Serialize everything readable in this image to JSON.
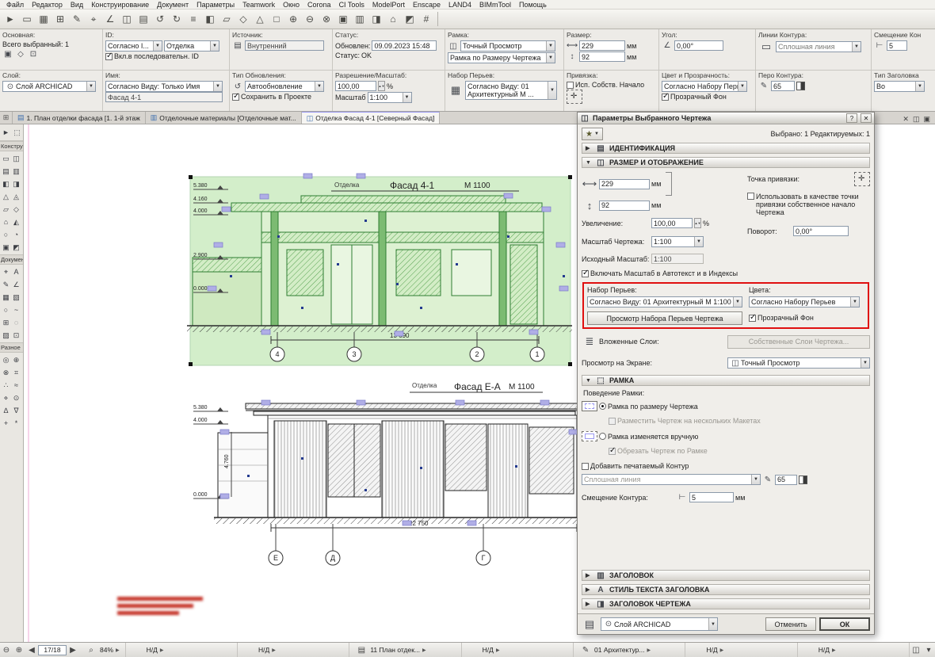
{
  "menubar": {
    "items": [
      "Файл",
      "Редактор",
      "Вид",
      "Конструирование",
      "Документ",
      "Параметры",
      "Teamwork",
      "Окно",
      "Corona",
      "CI Tools",
      "ModelPort",
      "Enscape",
      "LAND4",
      "BIMmTool",
      "Помощь"
    ]
  },
  "toolbar": {
    "icons": [
      "►",
      "▭",
      "▦",
      "⊞",
      "✎",
      "⌖",
      "∠",
      "◫",
      "▤",
      "↺",
      "↻",
      "≡",
      "◧",
      "▱",
      "◇",
      "△",
      "□",
      "⊕",
      "⊖",
      "⊗",
      "▣",
      "▥",
      "◨",
      "⌂",
      "◩",
      "#"
    ]
  },
  "infobox": {
    "basic": {
      "label": "Основная:",
      "selection": "Всего выбранный: 1"
    },
    "layer": {
      "label": "Слой:",
      "value": "Слой ARCHICAD"
    },
    "id": {
      "label": "ID:",
      "by": "Согласно I...",
      "value": "Отделка",
      "seq": "Вкл.в последовательн. ID"
    },
    "name": {
      "label": "Имя:",
      "by": "Согласно Виду: Только Имя",
      "value": "Фасад 4-1"
    },
    "source": {
      "label": "Источник:",
      "value": "Внутренний"
    },
    "update": {
      "label": "Тип Обновления:",
      "mode": "Автообновление",
      "store": "Сохранить в Проекте"
    },
    "status": {
      "label": "Статус:",
      "updated_label": "Обновлен:",
      "updated": "09.09.2023 15:48",
      "status_label": "Статус:",
      "status": "OK"
    },
    "resolution": {
      "label": "Разрешение/Масштаб:",
      "value": "100,00",
      "unit": "%",
      "scale_label": "Масштаб",
      "scale": "1:100"
    },
    "frame": {
      "label": "Рамка:",
      "preview": "Точный Просмотр",
      "mode": "Рамка по Размеру Чертежа"
    },
    "penset": {
      "label": "Набор Перьев:",
      "value": "Согласно Виду: 01 Архитектурный М ..."
    },
    "size": {
      "label": "Размер:",
      "width": "229",
      "height": "92",
      "unit": "мм"
    },
    "anchor": {
      "label": "Привязка:",
      "check": "Исп. Собств. Начало"
    },
    "angle": {
      "label": "Угол:",
      "value": "0,00°"
    },
    "color": {
      "label": "Цвет и Прозрачность:",
      "value": "Согласно Набору Перьев",
      "transparent": "Прозрачный Фон"
    },
    "contour": {
      "label": "Линии Контура:",
      "value": "Сплошная линия"
    },
    "pen": {
      "label": "Перо Контура:",
      "value": "65"
    },
    "offset": {
      "label": "Смещение Кон",
      "value": "5"
    },
    "titletype": {
      "label": "Тип Заголовка",
      "value": "Во"
    }
  },
  "tabs": {
    "items": [
      {
        "label": "1. План отделки фасада [1. 1-й этаж"
      },
      {
        "label": "Отделочные материалы [Отделочные мат..."
      },
      {
        "label": "Отделка Фасад 4-1 [Северный Фасад]"
      }
    ]
  },
  "palette": {
    "sections": [
      {
        "label": "Конструиро"
      },
      {
        "label": "Документы"
      },
      {
        "label": "Разное"
      }
    ],
    "construct_tools": [
      "▭",
      "◫",
      "▤",
      "▥",
      "◧",
      "◨",
      "△",
      "◬",
      "▱",
      "◇",
      "⌂",
      "◭",
      "○",
      "◔",
      "▣",
      "◩"
    ],
    "document_tools": [
      "⌖",
      "A",
      "✎",
      "∠",
      "▦",
      "▧",
      "○",
      "~",
      "⊞",
      "◌",
      "▨",
      "⊡"
    ],
    "misc_tools": [
      "◎",
      "⊕",
      "⊗",
      "⌗",
      "∴",
      "≈",
      "⋄",
      "⊙",
      "∆",
      "∇",
      "+",
      "*"
    ]
  },
  "canvas": {
    "d1": {
      "prefix": "Отделка",
      "title": "Фасад 4-1",
      "scale": "М 1100",
      "dim": "13 690",
      "bubbles": [
        "4",
        "3",
        "2",
        "1"
      ],
      "levels": [
        "5.380",
        "4.160",
        "4.000",
        "2.900",
        "0.000"
      ]
    },
    "d2": {
      "prefix": "Отделка",
      "title": "Фасад Е-А",
      "scale": "М 1100",
      "dim": "22 750",
      "vdim": "4.760",
      "bubbles": [
        "Е",
        "Д",
        "Г"
      ],
      "levels": [
        "5.380",
        "4.000",
        "0.000"
      ]
    }
  },
  "dialog": {
    "title": "Параметры Выбранного Чертежа",
    "help": "?",
    "selected_info": "Выбрано: 1 Редактируемых: 1",
    "sec_identification": "ИДЕНТИФИКАЦИЯ",
    "sec_size": "РАЗМЕР И ОТОБРАЖЕНИЕ",
    "size": {
      "width": "229",
      "height": "92",
      "unit_w": "мм",
      "unit_h": "мм",
      "anchor_label": "Точка привязки:",
      "magnify_label": "Увеличение:",
      "magnify": "100,00",
      "magnify_unit": "%",
      "own_origin": "Использовать в качестве точки привязки собственное начало Чертежа",
      "scale_label": "Масштаб Чертежа:",
      "scale": "1:100",
      "source_scale_label": "Исходный Масштаб:",
      "source_scale": "1:100",
      "rotation_label": "Поворот:",
      "rotation": "0,00°",
      "include_scale": "Включать Масштаб в Автотекст и в Индексы",
      "penset_label": "Набор Перьев:",
      "colors_label": "Цвета:",
      "penset": "Согласно Виду: 01 Архитектурный М 1:100",
      "colors": "Согласно Набору Перьев",
      "penset_preview": "Просмотр Набора Перьев Чертежа",
      "transparent": "Прозрачный Фон",
      "layers_label": "Вложенные Слои:",
      "layers_btn": "Собственные Слои Чертежа...",
      "onscreen_label": "Просмотр на Экране:",
      "onscreen": "Точный Просмотр"
    },
    "sec_frame": "РАМКА",
    "frame": {
      "behavior": "Поведение Рамки:",
      "fit": "Рамка по размеру Чертежа",
      "multi": "Разместить Чертеж на нескольких Макетах",
      "manual": "Рамка изменяется вручную",
      "crop": "Обрезать Чертеж по Рамке",
      "printable": "Добавить печатаемый Контур",
      "linetype": "Сплошная линия",
      "pen": "65",
      "offset_label": "Смещение Контура:",
      "offset": "5",
      "offset_unit": "мм"
    },
    "sec_title": "ЗАГОЛОВОК",
    "sec_title_style": "СТИЛЬ ТЕКСТА ЗАГОЛОВКА",
    "sec_drawing_title": "ЗАГОЛОВОК ЧЕРТЕЖА",
    "footer": {
      "layer": "Слой ARCHICAD",
      "cancel": "Отменить",
      "ok": "ОК"
    }
  },
  "statusbar": {
    "pager": "17/18",
    "zoom": "84%",
    "items": [
      {
        "icon": "",
        "label": "Н/Д"
      },
      {
        "icon": "",
        "label": "Н/Д"
      },
      {
        "icon": "▤",
        "label": "11 План отдек..."
      },
      {
        "icon": "",
        "label": "Н/Д"
      },
      {
        "icon": "✎",
        "label": "01 Архитектур..."
      },
      {
        "icon": "",
        "label": "Н/Д"
      },
      {
        "icon": "",
        "label": "Н/Д"
      }
    ]
  }
}
